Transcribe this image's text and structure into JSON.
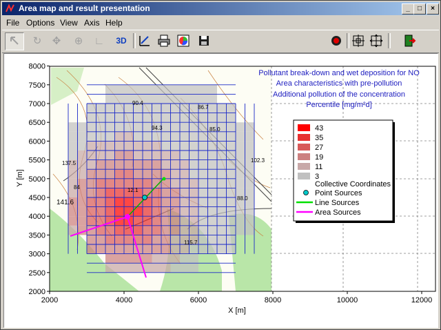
{
  "window": {
    "title": "Area map and result presentation"
  },
  "window_buttons": {
    "minimize": "_",
    "maximize": "□",
    "close": "×"
  },
  "menu": [
    "File",
    "Options",
    "View",
    "Axis",
    "Help"
  ],
  "toolbar": {
    "three_d_label": "3D"
  },
  "plot": {
    "title_lines": [
      "Pollutant break-down and wet deposition for NO",
      "Area characteristics with pre-pollution",
      "Additional pollution of the concentration",
      "Percentile [mg/m²d]"
    ],
    "x_axis": {
      "label": "X [m]",
      "ticks": [
        "2000",
        "4000",
        "6000",
        "8000",
        "10000",
        "12000"
      ]
    },
    "y_axis": {
      "label": "Y [m]",
      "ticks": [
        "2000",
        "2500",
        "3000",
        "3500",
        "4000",
        "4500",
        "5000",
        "5500",
        "6000",
        "6500",
        "7000",
        "7500",
        "8000"
      ]
    },
    "map_labels": [
      {
        "text": "90.4"
      },
      {
        "text": "86.7"
      },
      {
        "text": "94.3"
      },
      {
        "text": "85.0"
      },
      {
        "text": "137.5"
      },
      {
        "text": "102.3"
      },
      {
        "text": "12.1"
      },
      {
        "text": "88.0"
      },
      {
        "text": "141.6"
      },
      {
        "text": "115.7"
      },
      {
        "text": "84"
      }
    ]
  },
  "legend": {
    "classes": [
      {
        "label": "43",
        "color": "#ff0000"
      },
      {
        "label": "35",
        "color": "#e83030"
      },
      {
        "label": "27",
        "color": "#d85a5a"
      },
      {
        "label": "19",
        "color": "#cc8080"
      },
      {
        "label": "11",
        "color": "#c8a8a8"
      },
      {
        "label": "3",
        "color": "#c0c0c0"
      }
    ],
    "coordinates_label": "Collective Coordinates",
    "point_sources": {
      "label": "Point Sources",
      "color": "#00c8c8"
    },
    "line_sources": {
      "label": "Line Sources",
      "color": "#00e000"
    },
    "area_sources": {
      "label": "Area Sources",
      "color": "#ff00ff"
    }
  }
}
